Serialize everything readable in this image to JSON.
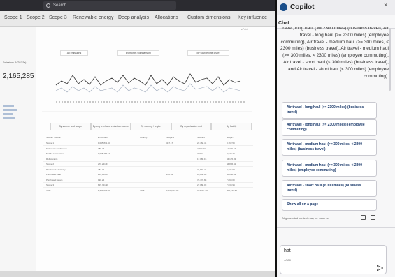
{
  "titlebar": {
    "search_placeholder": "Search"
  },
  "report": {
    "tabs": [
      "Scope 1",
      "Scope 2",
      "Scope 3",
      "Renewable energy",
      "Deep analysis",
      "Allocations",
      "Custom dimensions",
      "Key influence"
    ],
    "version": "v7.0.0",
    "kpi_label": "Emissions (MTCO2e)",
    "kpi_value": "2,165,285",
    "chip_emissions": "All emissions",
    "chip_month": "By month (comparison)",
    "chip_source": "By source (line chart)",
    "filters": [
      "By source and scope",
      "By org level and emission source",
      "By country / region",
      "By organization unit",
      "By facility"
    ],
    "table": {
      "headers": [
        "Scope / Source",
        "Emissions",
        "Country",
        "",
        "Scope 1",
        "Scope 2",
        "Scope 3"
      ],
      "rows": [
        [
          "Scope 1",
          "1,045,871.94",
          "",
          "",
          "387.17",
          "22,468.41",
          "8,162.59"
        ],
        [
          "Stationary combustion",
          "388.27",
          "",
          "",
          "",
          "2,004.03",
          "11,245.16"
        ],
        [
          "Mobile combustion",
          "1,045,483.19",
          "",
          "",
          "",
          "720.44",
          "8,879.40"
        ],
        [
          "Refrigerants",
          "",
          "",
          "",
          "",
          "17,080.15",
          "34,176.83"
        ],
        [
          "Scope 2",
          "270,241.43",
          "",
          "",
          "",
          "",
          "44,865.41"
        ],
        [
          "Purchased electricity",
          "282.39",
          "",
          "",
          "",
          "74,897.41",
          "2,235.98"
        ],
        [
          "Purchased heat",
          "269,959.04",
          "",
          "",
          "240.81",
          "10,848.86",
          "30,080.02"
        ],
        [
          "Purchased steam",
          "190.24",
          "",
          "",
          "",
          "78,778.88",
          "7,890.60"
        ],
        [
          "Scope 3",
          "815,721.96",
          "",
          "",
          "",
          "27,088.03",
          "7,039.94"
        ],
        [
          "Total",
          "2,131,034.64",
          "Total",
          "",
          "1,046,011.06",
          "331,547.28",
          "805,721.96"
        ]
      ]
    }
  },
  "copilot": {
    "title": "Copilot",
    "close_icon": "close-icon",
    "chat_label": "Chat",
    "response_text": "travel, long haul (>= 2300 miles) (business travel), Air travel - long haul (>= 2300 miles) (employee commuting), Air travel - medium haul (>= 300 miles, < 2300 miles) (business travel), Air travel - medium haul (>= 300 miles, < 2300 miles) (employee commuting), Air travel - short haul (< 300 miles) (business travel), and Air travel - short haul (< 300 miles) (employee commuting).",
    "suggestions": [
      "Air travel - long haul (>= 2300 miles) (business travel)",
      "Air travel - long haul (>= 2300 miles) (employee commuting)",
      "Air travel - medium haul (>= 300 miles, < 2300 miles) (business travel)",
      "Air travel - medium haul (>= 300 miles, < 2300 miles) (employee commuting)",
      "Air travel - short haul (< 300 miles) (business travel)",
      "Show all on a page"
    ],
    "disclaimer": "AI-generated content may be incorrect",
    "input_value": "hat",
    "char_count": "4/500"
  },
  "colors": {
    "accent": "#1a4e8a",
    "background_dark": "#1a1a1d",
    "link_blue": "#1b3a6b"
  }
}
